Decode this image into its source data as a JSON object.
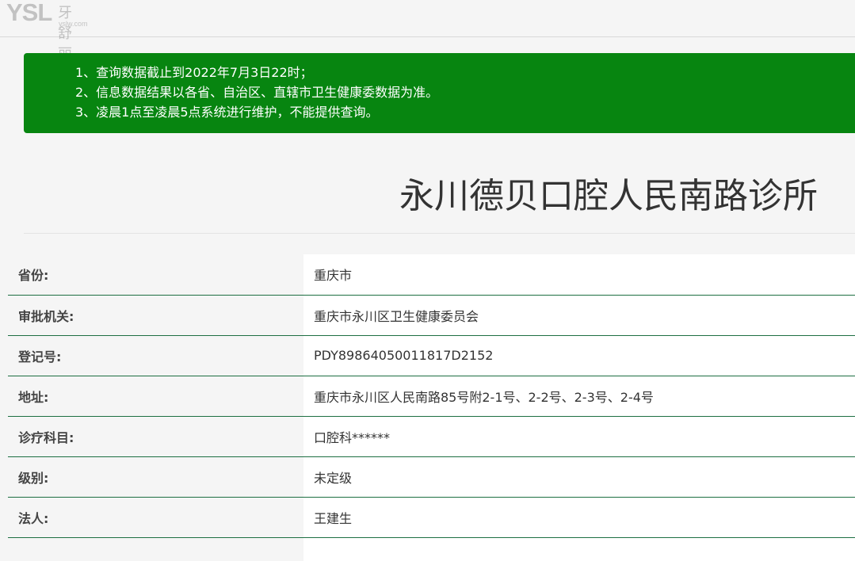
{
  "logo": {
    "brand": "YSL",
    "brand_cn": "牙舒丽",
    "domain": "yslw.com"
  },
  "notice": {
    "lines": [
      "1、查询数据截止到2022年7月3日22时；",
      "2、信息数据结果以各省、自治区、直辖市卫生健康委数据为准。",
      "3、凌晨1点至凌晨5点系统进行维护，不能提供查询。"
    ],
    "background_color": "#078510"
  },
  "clinic": {
    "name": "永川德贝口腔人民南路诊所"
  },
  "info_rows": [
    {
      "label": "省份:",
      "value": "重庆市"
    },
    {
      "label": "审批机关:",
      "value": "重庆市永川区卫生健康委员会"
    },
    {
      "label": "登记号:",
      "value": "PDY89864050011817D2152"
    },
    {
      "label": "地址:",
      "value": "重庆市永川区人民南路85号附2-1号、2-2号、2-3号、2-4号"
    },
    {
      "label": "诊疗科目:",
      "value": "口腔科******"
    },
    {
      "label": "级别:",
      "value": "未定级"
    },
    {
      "label": "法人:",
      "value": "王建生"
    }
  ]
}
